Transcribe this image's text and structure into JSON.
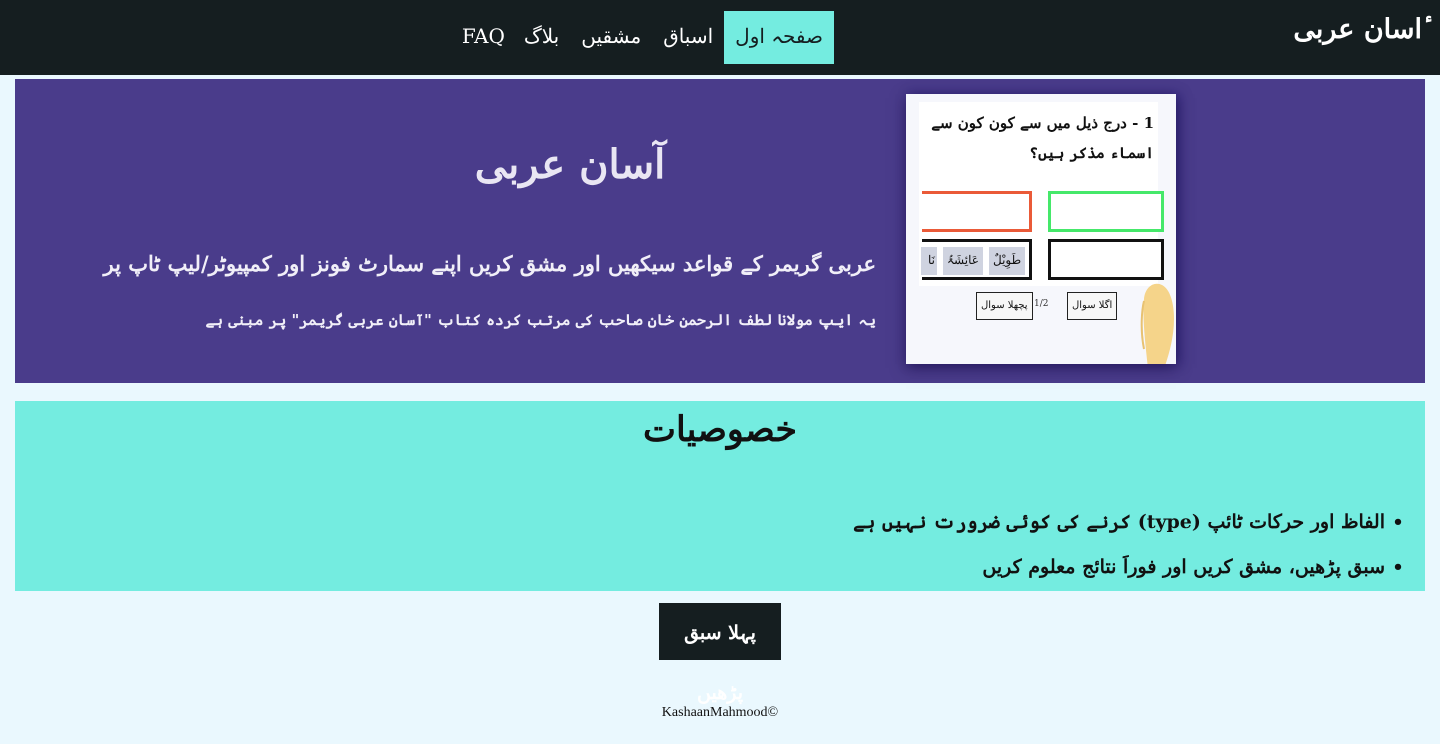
{
  "colors": {
    "navbar_bg": "#151e20",
    "active_tab": "#74ece0",
    "hero_bg": "#4a3c8b",
    "features_bg": "#74ece0",
    "page_bg": "#eaf8fe",
    "correct_border": "#45e86a",
    "wrong_border": "#ea5a38"
  },
  "navbar": {
    "brand": "ٔاسان عربی",
    "items": [
      {
        "label": "صفحہ اول",
        "active": true
      },
      {
        "label": "اسباق"
      },
      {
        "label": "مشقیں"
      },
      {
        "label": "بلاگ"
      },
      {
        "label": "FAQ"
      }
    ]
  },
  "hero": {
    "title": "آسان عربی",
    "subtitle": "عربی گریمر کے قواعد سیکھیں اور مشق کریں اپنے سمارٹ فونز اور کمپیوٹر/لیپ ٹاپ پر",
    "note": "یہ ایپ مولانا لطف الرحمن خان صاحب کی مرتب کردہ کتاب \"آسان عربی گریمر\" پر مبنی ہے",
    "demo": {
      "question_line1": "درج ذیل میں سے کون کون سے",
      "question_number": "1 -",
      "question_line2": "اسماء مذکر ہیں؟",
      "chips": [
        "طَوِیْلٌ",
        "عَائِشَۃُ",
        "نَا"
      ],
      "next_label": "اگلا سوال",
      "prev_label": "پچھلا سوال",
      "counter": "1/2"
    }
  },
  "features": {
    "title": "خصوصیات",
    "items": [
      "الفاظ اور حرکات ٹائپ (type) کرنے کی کوئی ضرورت نہیں ہے",
      "سبق پڑھیں، مشق کریں اور فوراََ نتائج معلوم کریں"
    ]
  },
  "cta": {
    "label": "پہلا سبق پڑھیں"
  },
  "footer": {
    "text": "KashaanMahmood©"
  }
}
